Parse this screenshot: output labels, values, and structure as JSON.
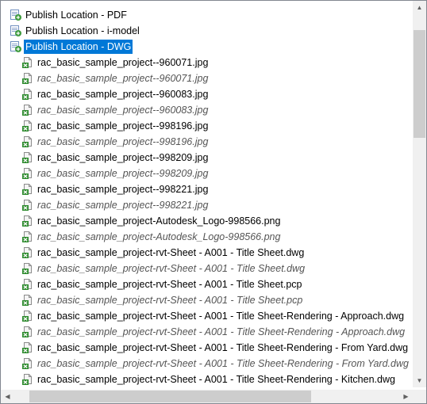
{
  "colors": {
    "selection": "#0078d7",
    "scrollbar_track": "#f0f0f0",
    "scrollbar_thumb": "#cdcdcd"
  },
  "tree": {
    "publish_locations": [
      {
        "label": "Publish Location - PDF",
        "icon": "publish-location-icon",
        "selected": false
      },
      {
        "label": "Publish Location - i-model",
        "icon": "publish-location-icon",
        "selected": false
      },
      {
        "label": "Publish Location - DWG",
        "icon": "publish-location-icon",
        "selected": true
      }
    ],
    "files": [
      {
        "label": "rac_basic_sample_project--960071.jpg",
        "style": "normal"
      },
      {
        "label": "rac_basic_sample_project--960071.jpg",
        "style": "italic"
      },
      {
        "label": "rac_basic_sample_project--960083.jpg",
        "style": "normal"
      },
      {
        "label": "rac_basic_sample_project--960083.jpg",
        "style": "italic"
      },
      {
        "label": "rac_basic_sample_project--998196.jpg",
        "style": "normal"
      },
      {
        "label": "rac_basic_sample_project--998196.jpg",
        "style": "italic"
      },
      {
        "label": "rac_basic_sample_project--998209.jpg",
        "style": "normal"
      },
      {
        "label": "rac_basic_sample_project--998209.jpg",
        "style": "italic"
      },
      {
        "label": "rac_basic_sample_project--998221.jpg",
        "style": "normal"
      },
      {
        "label": "rac_basic_sample_project--998221.jpg",
        "style": "italic"
      },
      {
        "label": "rac_basic_sample_project-Autodesk_Logo-998566.png",
        "style": "normal"
      },
      {
        "label": "rac_basic_sample_project-Autodesk_Logo-998566.png",
        "style": "italic"
      },
      {
        "label": "rac_basic_sample_project-rvt-Sheet - A001 - Title Sheet.dwg",
        "style": "normal"
      },
      {
        "label": "rac_basic_sample_project-rvt-Sheet - A001 - Title Sheet.dwg",
        "style": "italic"
      },
      {
        "label": "rac_basic_sample_project-rvt-Sheet - A001 - Title Sheet.pcp",
        "style": "normal"
      },
      {
        "label": "rac_basic_sample_project-rvt-Sheet - A001 - Title Sheet.pcp",
        "style": "italic"
      },
      {
        "label": "rac_basic_sample_project-rvt-Sheet - A001 - Title Sheet-Rendering - Approach.dwg",
        "style": "normal"
      },
      {
        "label": "rac_basic_sample_project-rvt-Sheet - A001 - Title Sheet-Rendering - Approach.dwg",
        "style": "italic"
      },
      {
        "label": "rac_basic_sample_project-rvt-Sheet - A001 - Title Sheet-Rendering - From Yard.dwg",
        "style": "normal"
      },
      {
        "label": "rac_basic_sample_project-rvt-Sheet - A001 - Title Sheet-Rendering - From Yard.dwg",
        "style": "italic"
      },
      {
        "label": "rac_basic_sample_project-rvt-Sheet - A001 - Title Sheet-Rendering - Kitchen.dwg",
        "style": "normal"
      }
    ]
  },
  "scrollbars": {
    "vertical_position": 0.0,
    "horizontal_position": 0.0
  }
}
